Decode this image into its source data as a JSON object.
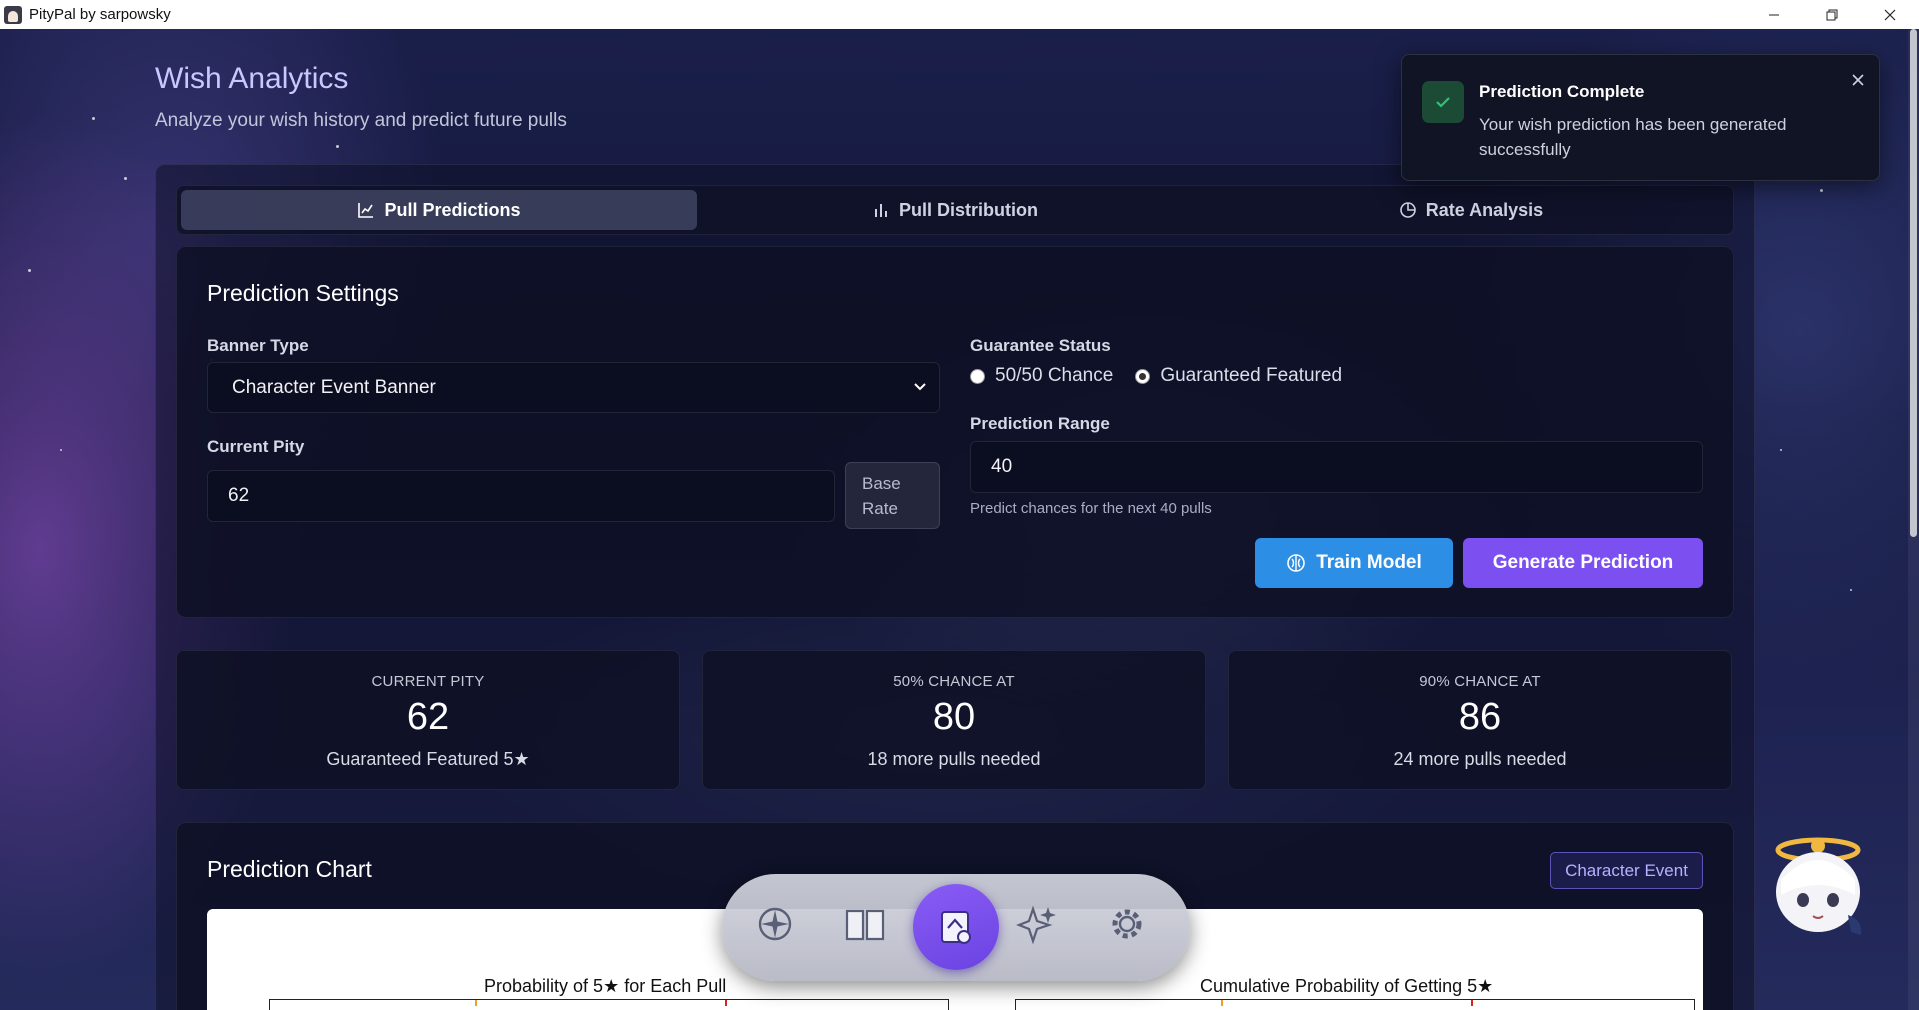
{
  "window": {
    "title": "PityPal by sarpowsky"
  },
  "page": {
    "title": "Wish Analytics",
    "subtitle": "Analyze your wish history and predict future pulls"
  },
  "tabs": [
    {
      "label": "Pull Predictions",
      "icon": "line-chart-icon",
      "active": true
    },
    {
      "label": "Pull Distribution",
      "icon": "bar-chart-icon",
      "active": false
    },
    {
      "label": "Rate Analysis",
      "icon": "pie-chart-icon",
      "active": false
    }
  ],
  "settings": {
    "title": "Prediction Settings",
    "banner_type_label": "Banner Type",
    "banner_type_value": "Character Event Banner",
    "current_pity_label": "Current Pity",
    "current_pity_value": "62",
    "base_rate_label": "Base Rate",
    "guarantee_label": "Guarantee Status",
    "guarantee_options": [
      {
        "label": "50/50 Chance",
        "selected": false
      },
      {
        "label": "Guaranteed Featured",
        "selected": true
      }
    ],
    "range_label": "Prediction Range",
    "range_value": "40",
    "range_helper": "Predict chances for the next 40 pulls",
    "train_button": "Train Model",
    "generate_button": "Generate Prediction"
  },
  "stats": [
    {
      "label": "CURRENT PITY",
      "value": "62",
      "note": "Guaranteed Featured 5★"
    },
    {
      "label": "50% CHANCE AT",
      "value": "80",
      "note": "18 more pulls needed"
    },
    {
      "label": "90% CHANCE AT",
      "value": "86",
      "note": "24 more pulls needed"
    }
  ],
  "chart": {
    "title": "Prediction Chart",
    "badge": "Character Event",
    "left_plot_title": "Probability of 5★ for Each Pull",
    "right_plot_title": "Cumulative Probability of Getting 5★"
  },
  "toast": {
    "title": "Prediction Complete",
    "message": "Your wish prediction has been generated successfully"
  },
  "dock": {
    "items": [
      "compass-icon",
      "book-icon",
      "analytics-icon",
      "sparkles-icon",
      "gear-icon"
    ],
    "active": "analytics-icon"
  },
  "colors": {
    "accent_purple": "#7c4ff0",
    "accent_blue": "#2d8ee6",
    "title_lavender": "#c9c7ff",
    "success_green": "#34c07a"
  }
}
